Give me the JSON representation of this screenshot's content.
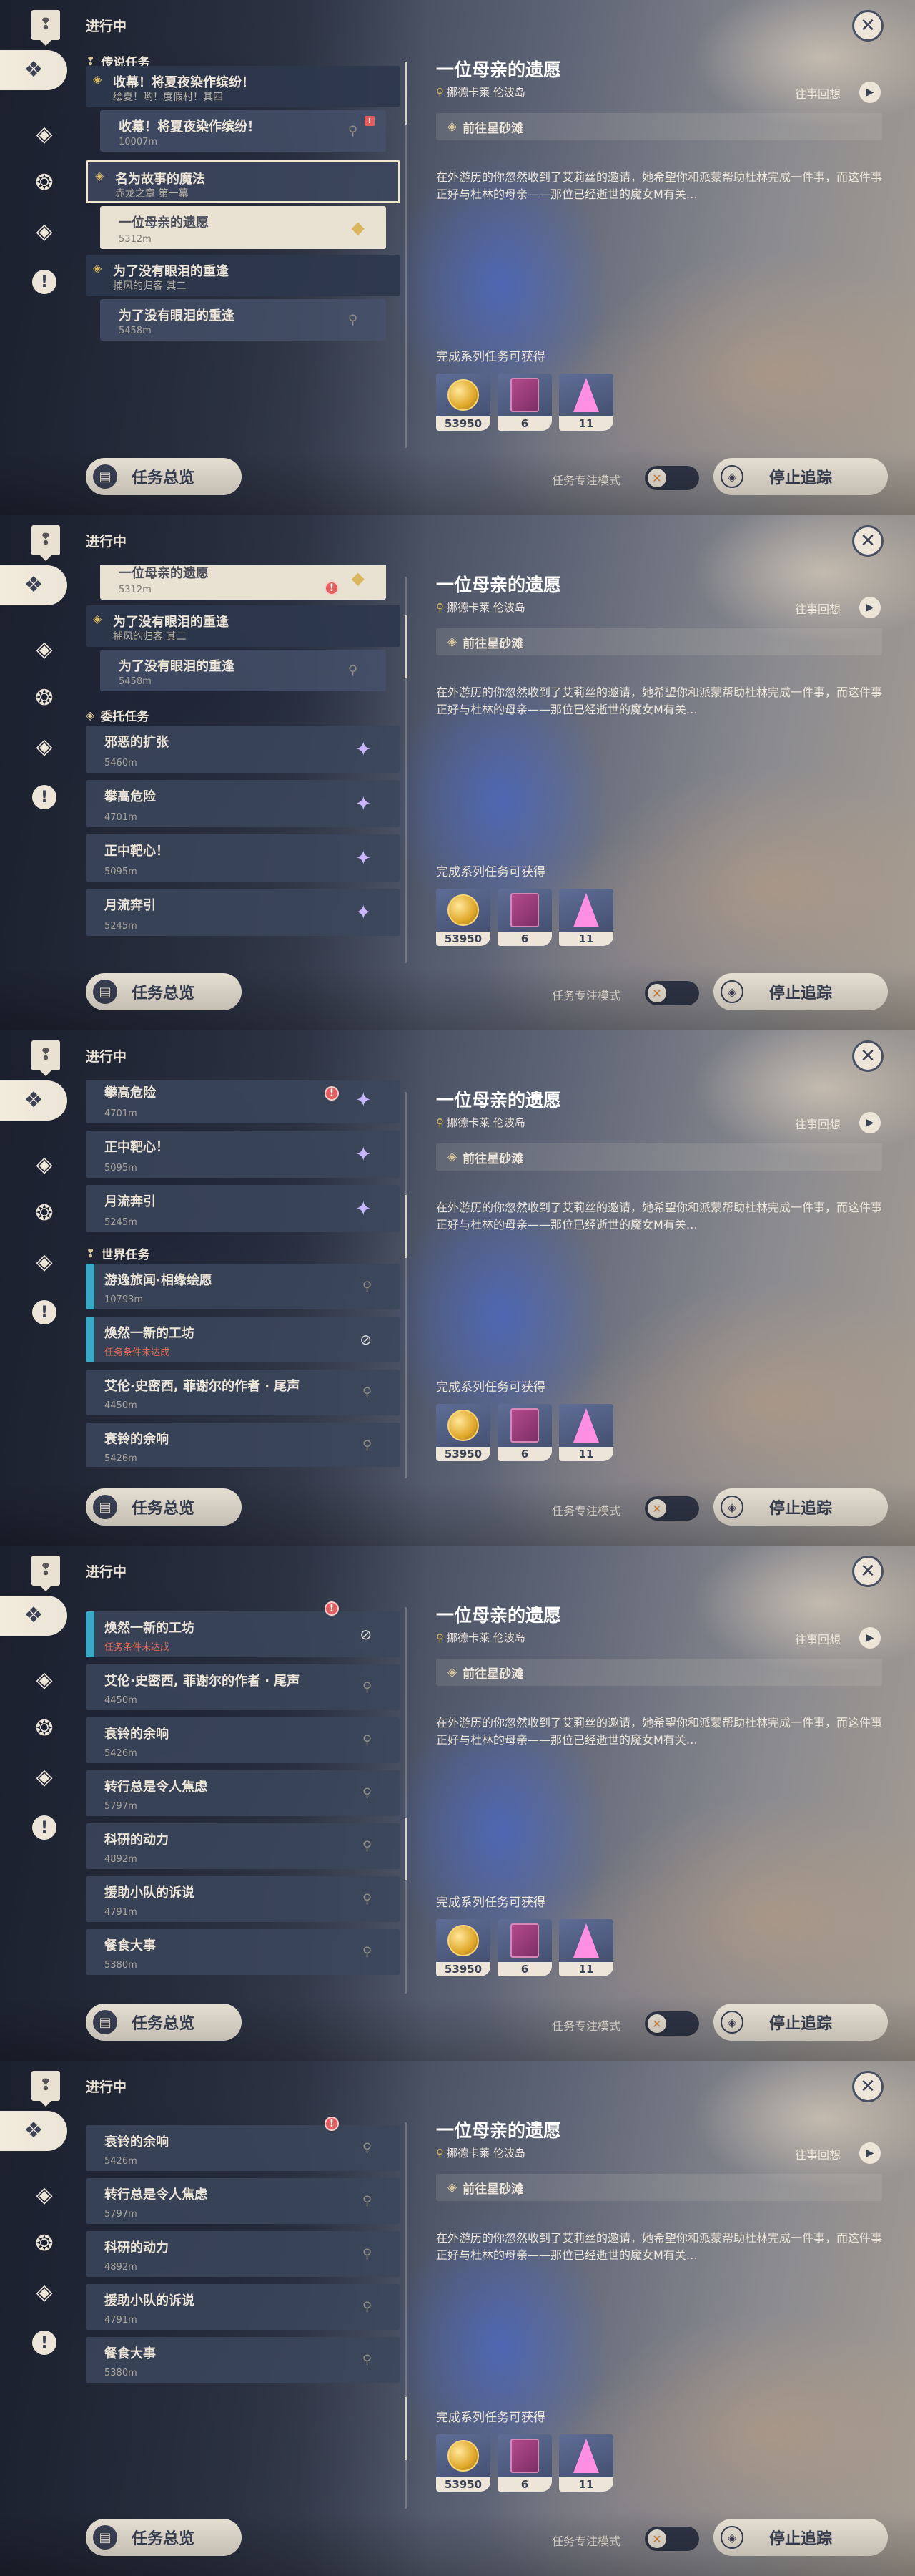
{
  "nav": {
    "header_title": "进行中",
    "rail": [
      {
        "icon": "quest-marker-icon",
        "glyph": "❢"
      },
      {
        "icon": "all-quests-icon",
        "glyph": "❖"
      },
      {
        "icon": "archon-quest-icon",
        "glyph": "◈"
      },
      {
        "icon": "story-quest-icon",
        "glyph": "❂"
      },
      {
        "icon": "world-quest-icon",
        "glyph": "◈"
      },
      {
        "icon": "exclamation-quest-icon",
        "glyph": "!"
      }
    ],
    "close_icon": "close-icon"
  },
  "sections": {
    "legend": "传说任务",
    "commission": "委托任务",
    "world": "世界任务"
  },
  "detail": {
    "title": "一位母亲的遗愿",
    "location": "挪德卡莱 伦波岛",
    "review_label": "往事回想",
    "step_label": "前往星砂滩",
    "description": "在外游历的你忽然收到了艾莉丝的邀请，她希望你和派蒙帮助杜林完成一件事，而这件事正好与杜林的母亲——那位已经逝世的魔女M有关…",
    "rewards_label": "完成系列任务可获得",
    "rewards": [
      {
        "kind": "mora-icon",
        "count": "53950"
      },
      {
        "kind": "hero-wit-book-icon",
        "count": "6"
      },
      {
        "kind": "primogem-icon",
        "count": "11"
      }
    ]
  },
  "footer": {
    "overview_label": "任务总览",
    "focus_label": "任务专注模式",
    "stop_label": "停止追踪",
    "toggle_glyph": "✕"
  },
  "quests": {
    "summer_parent": {
      "title": "收幕！将夏夜染作缤纷！",
      "subtitle": "绘夏！哟！度假村！其四"
    },
    "summer_child": {
      "title": "收幕！将夏夜染作缤纷！",
      "distance": "10007m"
    },
    "magic_parent": {
      "title": "名为故事的魔法",
      "subtitle": "赤龙之章 第一幕"
    },
    "mother_child": {
      "title": "一位母亲的遗愿",
      "distance": "5312m"
    },
    "tears_parent": {
      "title": "为了没有眼泪的重逢",
      "subtitle": "捕风的归客 其二"
    },
    "tears_child": {
      "title": "为了没有眼泪的重逢",
      "distance": "5458m"
    },
    "evil": {
      "title": "邪恶的扩张",
      "distance": "5460m"
    },
    "climb": {
      "title": "攀高危险",
      "distance": "4701m"
    },
    "bullseye": {
      "title": "正中靶心！",
      "distance": "5095m"
    },
    "moon": {
      "title": "月流奔引",
      "distance": "5245m"
    },
    "travel": {
      "title": "游逸旅闻·相缘绘愿",
      "distance": "10793m"
    },
    "workshop": {
      "title": "焕然一新的工坊",
      "distance": "任务条件未达成",
      "warn": true
    },
    "alan": {
      "title": "艾伦·史密西, 菲谢尔的作者 · 尾声",
      "distance": "4450m"
    },
    "bell": {
      "title": "衰铃的余响",
      "distance": "5426m"
    },
    "mind": {
      "title": "转行总是令人焦虑",
      "distance": "5797m"
    },
    "research": {
      "title": "科研的动力",
      "distance": "4892m"
    },
    "lawsuit": {
      "title": "援助小队的诉说",
      "distance": "4791m"
    },
    "food": {
      "title": "餐食大事",
      "distance": "5380m"
    }
  }
}
